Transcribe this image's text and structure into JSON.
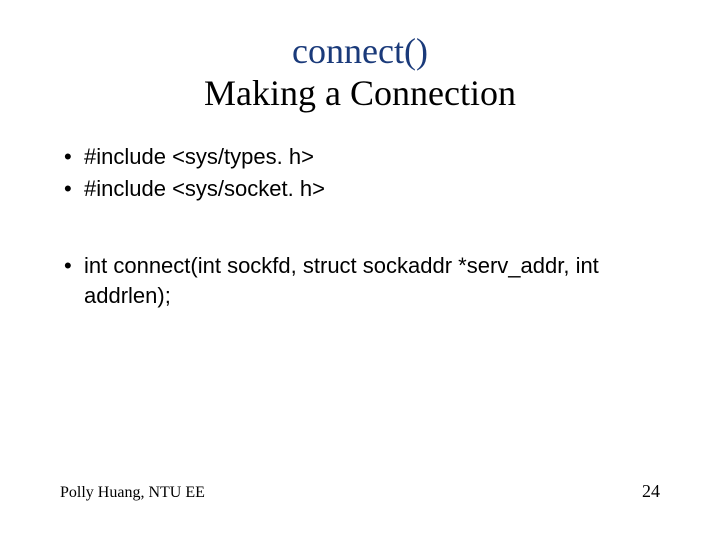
{
  "title": {
    "function": "connect()",
    "subtitle": "Making a Connection"
  },
  "bullets_group1": [
    "#include <sys/types. h>",
    "#include <sys/socket. h>"
  ],
  "bullets_group2": [
    "int connect(int sockfd, struct sockaddr *serv_addr, int addrlen);"
  ],
  "footer": {
    "author": "Polly Huang, NTU EE",
    "page": "24"
  }
}
